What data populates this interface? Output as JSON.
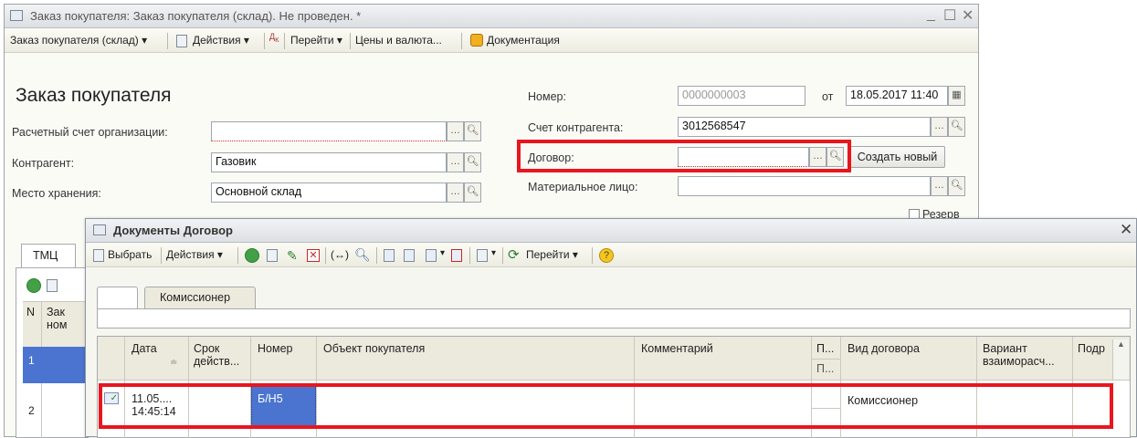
{
  "main_window": {
    "title": "Заказ покупателя: Заказ покупателя (склад). Не проведен. *",
    "toolbar": {
      "menu_order": "Заказ покупателя (склад) ▾",
      "actions": "Действия ▾",
      "dt_kt": "Дт Кт",
      "goto": "Перейти ▾",
      "prices": "Цены и валюта...",
      "docs": "Документация"
    },
    "form_title": "Заказ покупателя",
    "labels": {
      "account": "Расчетный счет организации:",
      "counterparty": "Контрагент:",
      "storage": "Место хранения:",
      "number": "Номер:",
      "from": "от",
      "cp_account": "Счет контрагента:",
      "contract": "Договор:",
      "mat_person": "Материальное лицо:",
      "reserve": "Резерв"
    },
    "values": {
      "account": "",
      "counterparty": "Газовик",
      "storage": "Основной склад",
      "number": "0000000003",
      "date": "18.05.2017 11:40",
      "cp_account": "3012568547",
      "contract": "",
      "mat_person": ""
    },
    "create_new": "Создать новый",
    "tab": "ТМЦ",
    "left_grid": {
      "col_n": "N",
      "col_zak": "Зак",
      "col_nom": "ном",
      "rows": [
        "1",
        "2"
      ]
    }
  },
  "dialog": {
    "title": "Документы Договор",
    "toolbar": {
      "select": "Выбрать",
      "actions": "Действия ▾",
      "goto": "Перейти ▾"
    },
    "tab": "Комиссионер",
    "columns": [
      "Дата",
      "Срок действ...",
      "Номер",
      "Объект покупателя",
      "Комментарий",
      "П...",
      "Вид договора",
      "Вариант взаиморасч...",
      "Подр"
    ],
    "row": {
      "date": "11.05....",
      "time": "14:45:14",
      "term": "",
      "number": "Б/Н5",
      "object": "",
      "comment": "",
      "p": "",
      "kind": "Комиссионер",
      "variant": "",
      "podr": ""
    }
  },
  "colors": {
    "highlight_red": "#e8161e",
    "selection_blue": "#4a74d0"
  }
}
